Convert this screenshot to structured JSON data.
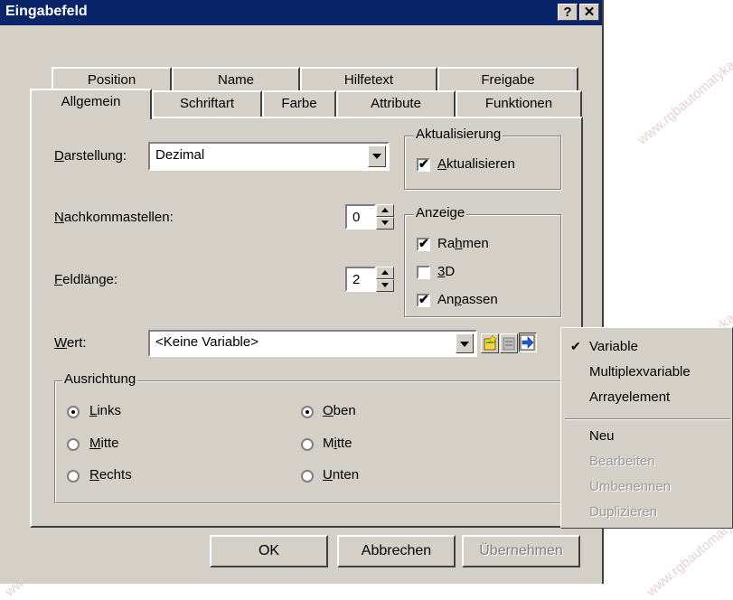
{
  "window": {
    "title": "Eingabefeld",
    "help_btn": "?",
    "close_btn": "✕"
  },
  "tabs": {
    "row1": [
      "Position",
      "Name",
      "Hilfetext",
      "Freigabe"
    ],
    "row2": [
      "Allgemein",
      "Schriftart",
      "Farbe",
      "Attribute",
      "Funktionen"
    ],
    "active": "Allgemein"
  },
  "form": {
    "darstellung_label": "Darstellung:",
    "darstellung_value": "Dezimal",
    "nachkomma_label": "Nachkommastellen:",
    "nachkomma_value": "0",
    "feldlaenge_label": "Feldlänge:",
    "feldlaenge_value": "2",
    "wert_label": "Wert:",
    "wert_value": "<Keine Variable>"
  },
  "aktualisierung": {
    "title": "Aktualisierung",
    "checkbox_label": "Aktualisieren",
    "checked": true
  },
  "anzeige": {
    "title": "Anzeige",
    "items": [
      {
        "label": "Rahmen",
        "checked": true
      },
      {
        "label": "3D",
        "checked": false
      },
      {
        "label": "Anpassen",
        "checked": true
      }
    ]
  },
  "ausrichtung": {
    "title": "Ausrichtung",
    "horizontal": [
      {
        "label": "Links",
        "selected": true
      },
      {
        "label": "Mitte",
        "selected": false
      },
      {
        "label": "Rechts",
        "selected": false
      }
    ],
    "vertical": [
      {
        "label": "Oben",
        "selected": true
      },
      {
        "label": "Mitte",
        "selected": false
      },
      {
        "label": "Unten",
        "selected": false
      }
    ]
  },
  "buttons": {
    "ok": "OK",
    "cancel": "Abbrechen",
    "apply": "Übernehmen"
  },
  "context_menu": {
    "items": [
      {
        "label": "Variable",
        "checked": true,
        "enabled": true
      },
      {
        "label": "Multiplexvariable",
        "enabled": true
      },
      {
        "label": "Arrayelement",
        "enabled": true
      },
      {
        "label": "Neu",
        "enabled": true
      },
      {
        "label": "Bearbeiten",
        "enabled": false
      },
      {
        "label": "Umbenennen",
        "enabled": false
      },
      {
        "label": "Duplizieren",
        "enabled": false
      }
    ]
  },
  "watermark": "www.rgbautomatyka.pl",
  "colors": {
    "titlebar": "#0a246a",
    "face": "#d4d0c8",
    "highlight": "#ffffff",
    "shadow": "#808080"
  }
}
